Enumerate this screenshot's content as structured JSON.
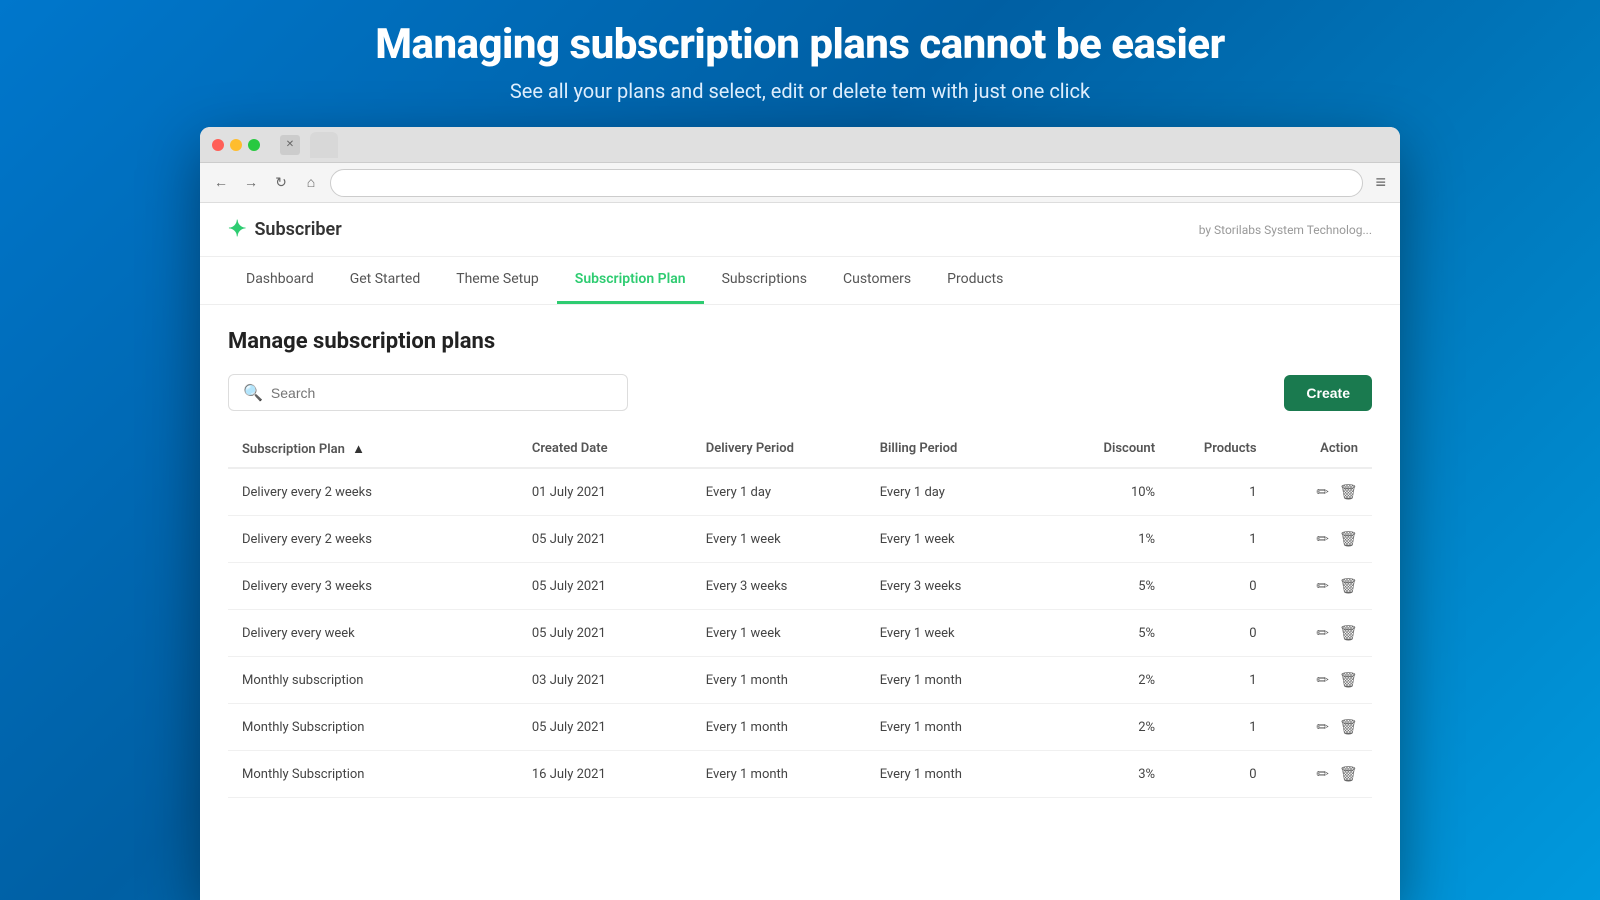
{
  "hero": {
    "title": "Managing subscription plans cannot be easier",
    "subtitle": "See all your plans and select, edit or delete tem with just one click"
  },
  "browser": {
    "tab_label": "",
    "address": "",
    "menu_icon": "≡"
  },
  "app": {
    "logo_icon": "✦",
    "logo_text": "Subscriber",
    "tagline": "by Storilabs System Technolog..."
  },
  "nav": {
    "items": [
      {
        "label": "Dashboard",
        "active": false
      },
      {
        "label": "Get Started",
        "active": false
      },
      {
        "label": "Theme Setup",
        "active": false
      },
      {
        "label": "Subscription Plan",
        "active": true
      },
      {
        "label": "Subscriptions",
        "active": false
      },
      {
        "label": "Customers",
        "active": false
      },
      {
        "label": "Products",
        "active": false
      }
    ]
  },
  "page": {
    "title": "Manage subscription plans",
    "search_placeholder": "Search",
    "create_label": "Create"
  },
  "table": {
    "columns": [
      {
        "label": "Subscription Plan",
        "sort": true
      },
      {
        "label": "Created Date"
      },
      {
        "label": "Delivery Period"
      },
      {
        "label": "Billing Period"
      },
      {
        "label": "Discount"
      },
      {
        "label": "Products"
      },
      {
        "label": "Action"
      }
    ],
    "rows": [
      {
        "plan": "Delivery every 2 weeks",
        "created": "01 July 2021",
        "delivery": "Every 1 day",
        "billing": "Every 1 day",
        "discount": "10%",
        "products": "1"
      },
      {
        "plan": "Delivery every 2 weeks",
        "created": "05 July 2021",
        "delivery": "Every 1 week",
        "billing": "Every 1 week",
        "discount": "1%",
        "products": "1"
      },
      {
        "plan": "Delivery every 3 weeks",
        "created": "05 July 2021",
        "delivery": "Every 3 weeks",
        "billing": "Every 3 weeks",
        "discount": "5%",
        "products": "0"
      },
      {
        "plan": "Delivery every week",
        "created": "05 July 2021",
        "delivery": "Every 1 week",
        "billing": "Every 1 week",
        "discount": "5%",
        "products": "0"
      },
      {
        "plan": "Monthly subscription",
        "created": "03 July 2021",
        "delivery": "Every 1 month",
        "billing": "Every 1 month",
        "discount": "2%",
        "products": "1"
      },
      {
        "plan": "Monthly Subscription",
        "created": "05 July 2021",
        "delivery": "Every 1 month",
        "billing": "Every 1 month",
        "discount": "2%",
        "products": "1"
      },
      {
        "plan": "Monthly Subscription",
        "created": "16 July 2021",
        "delivery": "Every 1 month",
        "billing": "Every 1 month",
        "discount": "3%",
        "products": "0"
      }
    ]
  }
}
